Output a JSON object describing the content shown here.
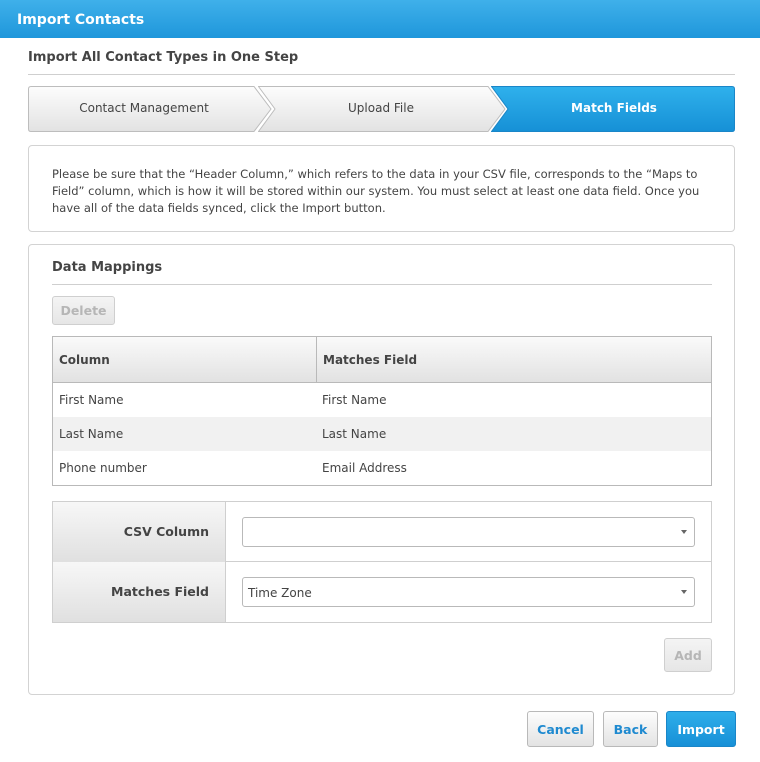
{
  "window": {
    "title": "Import Contacts"
  },
  "page": {
    "subtitle": "Import All Contact Types in One Step"
  },
  "steps": [
    {
      "label": "Contact Management",
      "active": false
    },
    {
      "label": "Upload File",
      "active": false
    },
    {
      "label": "Match Fields",
      "active": true
    }
  ],
  "info_text": "Please be sure that the “Header Column,” which refers to the data in your CSV file, corresponds to the “Maps to Field” column, which is how it will be stored within our system. You must select at least one data field. Once you have all of the data fields synced, click the Import button.",
  "mappings": {
    "title": "Data Mappings",
    "delete_label": "Delete",
    "columns": [
      "Column",
      "Matches Field"
    ],
    "rows": [
      [
        "First Name",
        "First Name"
      ],
      [
        "Last Name",
        "Last Name"
      ],
      [
        "Phone number",
        "Email Address"
      ]
    ],
    "form": {
      "csv_column_label": "CSV Column",
      "csv_column_value": "",
      "matches_field_label": "Matches Field",
      "matches_field_value": "Time Zone"
    },
    "add_label": "Add"
  },
  "footer": {
    "cancel_label": "Cancel",
    "back_label": "Back",
    "import_label": "Import"
  },
  "colors": {
    "accent": "#1f97db",
    "link": "#1f8ad0"
  }
}
